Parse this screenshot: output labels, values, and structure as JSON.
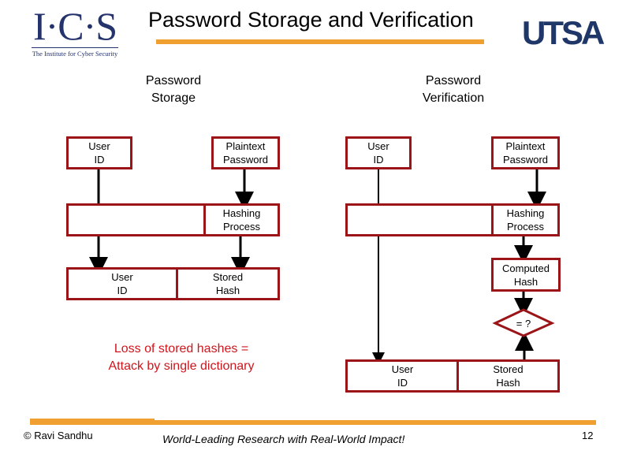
{
  "header": {
    "title": "Password Storage and Verification",
    "logo_left": {
      "mark": "I·C·S",
      "subtitle": "The Institute for Cyber Security"
    },
    "logo_right": {
      "mark": "UTSA"
    }
  },
  "storage": {
    "heading": "Password\nStorage",
    "user_id": "User\nID",
    "plaintext": "Plaintext\nPassword",
    "hashing": "Hashing\nProcess",
    "stored_user_id": "User\nID",
    "stored_hash": "Stored\nHash",
    "note": "Loss of stored hashes =\nAttack by single dictionary"
  },
  "verification": {
    "heading": "Password\nVerification",
    "user_id": "User\nID",
    "plaintext": "Plaintext\nPassword",
    "hashing": "Hashing\nProcess",
    "computed_hash": "Computed\nHash",
    "compare": "= ?",
    "stored_user_id": "User\nID",
    "stored_hash": "Stored\nHash"
  },
  "colors": {
    "accent_orange": "#f0a030",
    "box_border": "#9a1418",
    "note_red": "#d0141c",
    "brand_blue": "#24336b"
  },
  "footer": {
    "author": "© Ravi  Sandhu",
    "tagline": "World-Leading Research with Real-World Impact!",
    "page_number": "12"
  }
}
